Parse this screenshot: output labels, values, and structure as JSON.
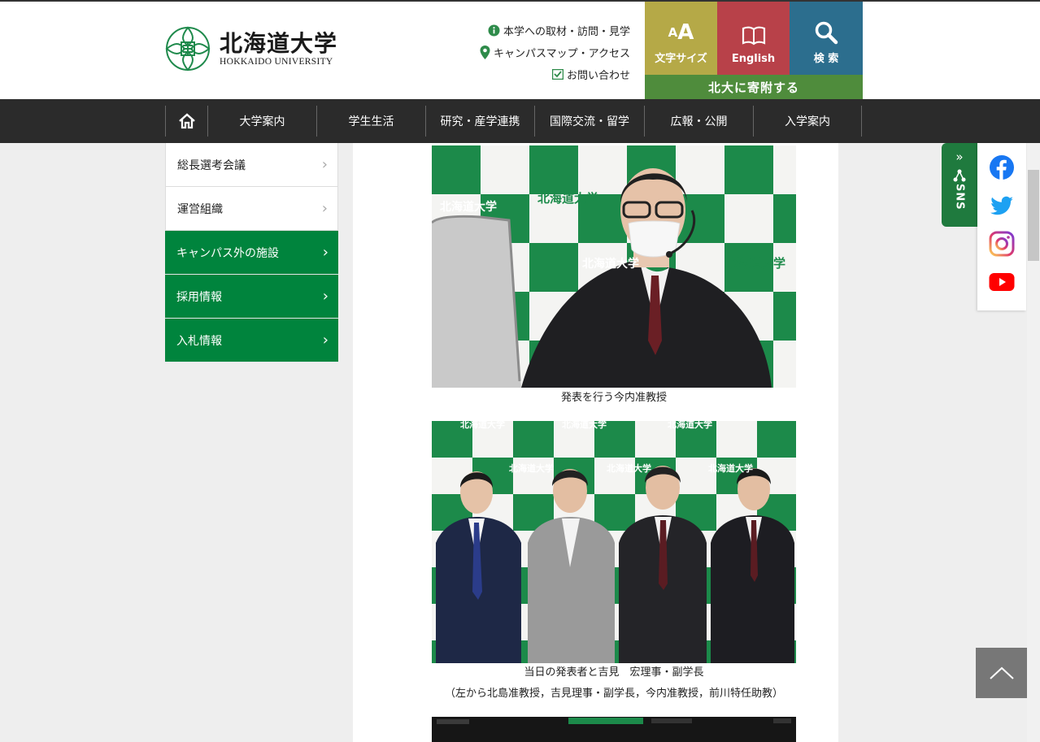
{
  "header": {
    "logo_ja": "北海道大学",
    "logo_en": "HOKKAIDO UNIVERSITY",
    "util_links": [
      {
        "label": "本学への取材・訪問・見学",
        "icon": "info-icon"
      },
      {
        "label": "キャンパスマップ・アクセス",
        "icon": "map-pin-icon"
      },
      {
        "label": "お問い合わせ",
        "icon": "mail-icon"
      }
    ],
    "buttons": {
      "font_size": "文字サイズ",
      "font_size_icon_text": "AA",
      "english": "English",
      "search": "検 索"
    },
    "donate": "北大に寄附する",
    "colors": {
      "font_size_bg": "#b5a947",
      "english_bg": "#b84149",
      "search_bg": "#2c6e8e",
      "donate_bg": "#4f8c3c",
      "brand_green": "#00843d"
    }
  },
  "nav": {
    "items": [
      "大学案内",
      "学生生活",
      "研究・産学連携",
      "国際交流・留学",
      "広報・公開",
      "入学案内"
    ]
  },
  "sidebar": {
    "items": [
      {
        "label": "総長選考会議",
        "style": "white"
      },
      {
        "label": "運営組織",
        "style": "white"
      },
      {
        "label": "キャンパス外の施設",
        "style": "green"
      },
      {
        "label": "採用情報",
        "style": "green"
      },
      {
        "label": "入札情報",
        "style": "green"
      }
    ]
  },
  "content": {
    "captions": [
      "発表を行う今内准教授",
      "当日の発表者と吉見　宏理事・副学長",
      "（左から北島准教授，吉見理事・副学長，今内准教授，前川特任助教）"
    ],
    "backdrop_text": "北海道大学",
    "backdrop_sub": "HOKKAIDO UNIVERSITY"
  },
  "sns": {
    "label": "SNS",
    "icons": [
      "facebook-icon",
      "twitter-icon",
      "instagram-icon",
      "youtube-icon"
    ]
  }
}
